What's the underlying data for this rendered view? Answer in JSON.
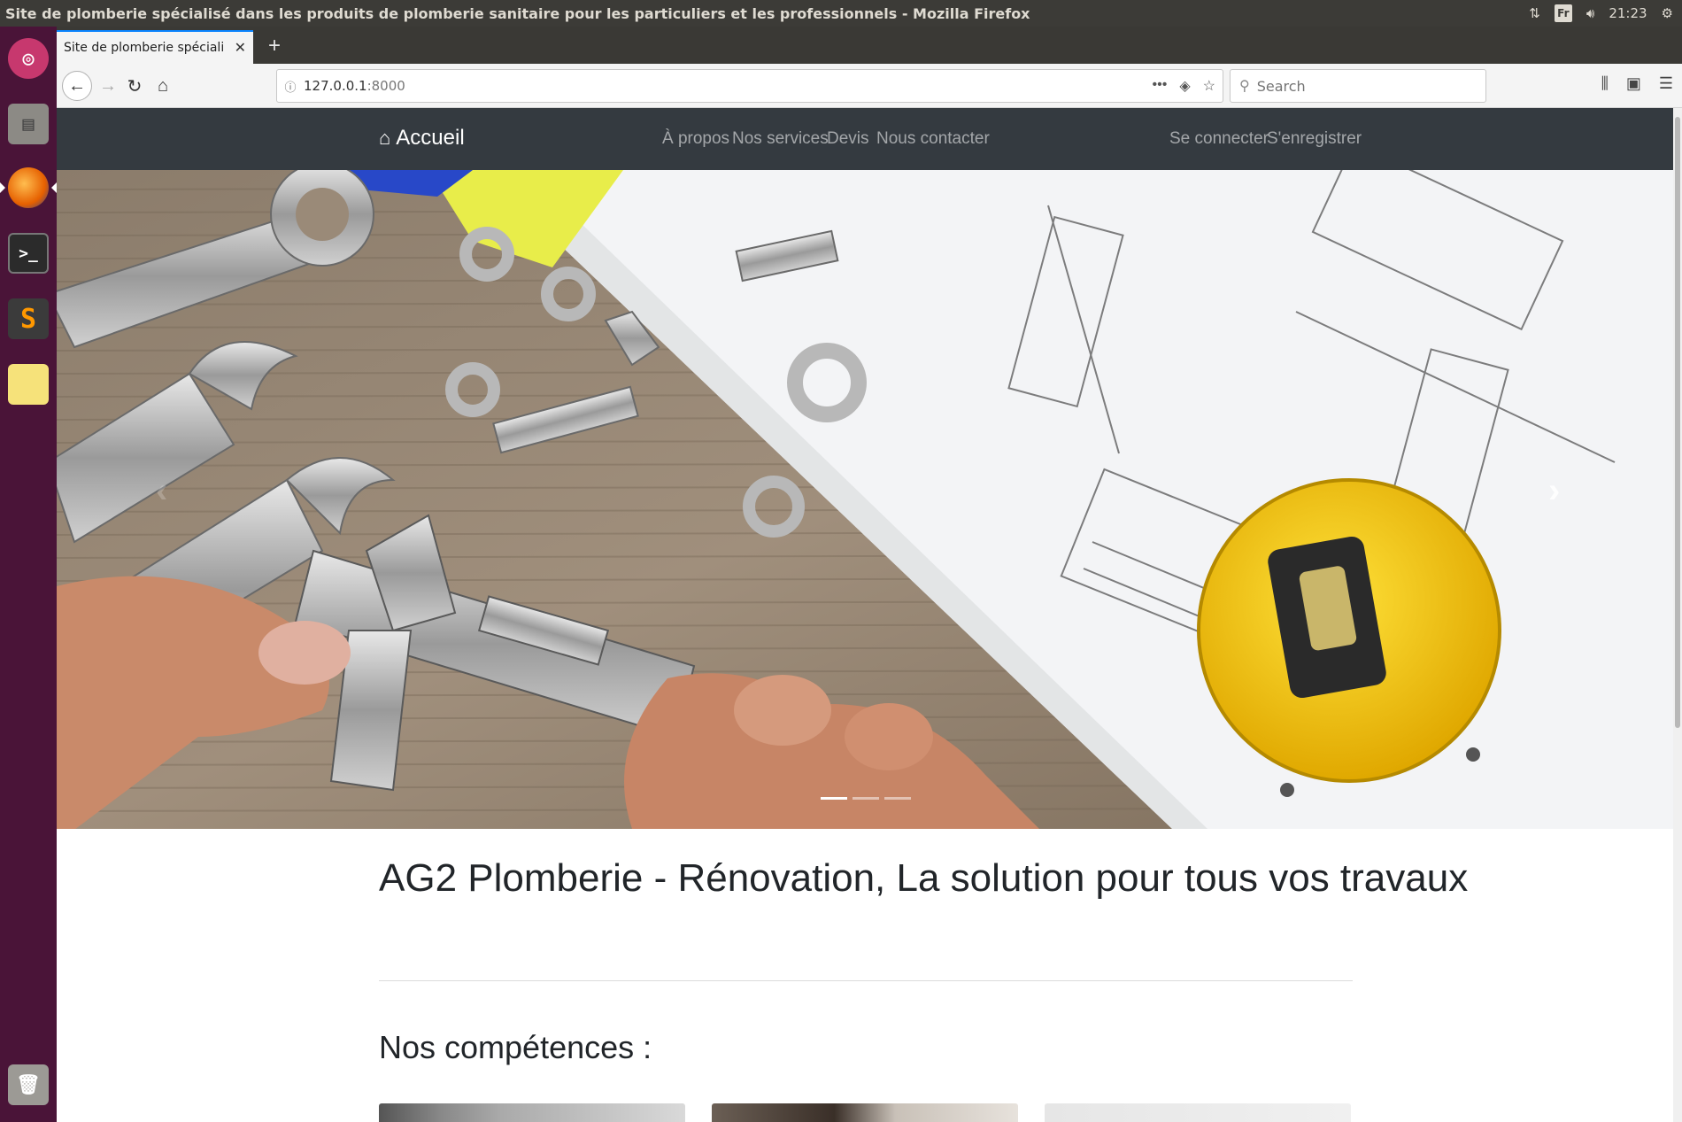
{
  "os": {
    "window_title": "Site de plomberie spécialisé dans les produits de plomberie sanitaire pour les particuliers et les professionnels - Mozilla Firefox",
    "keyboard": "Fr",
    "time": "21:23"
  },
  "launcher": [
    "ubuntu-dash",
    "files",
    "firefox",
    "terminal",
    "sublime-text",
    "notes",
    "trash"
  ],
  "browser": {
    "tab_title": "Site de plomberie spécialisé",
    "url_host": "127.0.0.1",
    "url_port": ":8000",
    "search_placeholder": "Search"
  },
  "site": {
    "brand": "Accueil",
    "nav_links": [
      "À propos",
      "Nos services",
      "Devis",
      "Nous contacter"
    ],
    "auth_links": [
      "Se connecter",
      "S'enregistrer"
    ],
    "carousel": {
      "slides": 3,
      "active_slide": 1
    },
    "headline": "AG2 Plomberie - Rénovation, La solution pour tous vos travaux",
    "section_title": "Nos compétences :"
  },
  "colors": {
    "navbar_bg": "#343a40",
    "launcher_bg": "#4a1438",
    "os_bar_bg": "#3c3b37",
    "tape_yellow": "#f2c40f"
  }
}
